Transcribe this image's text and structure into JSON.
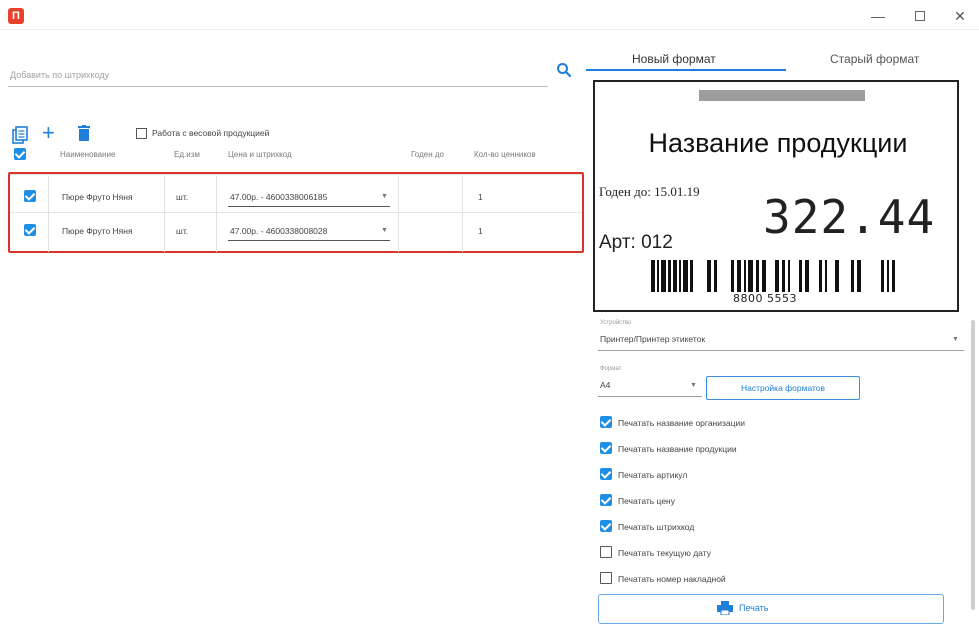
{
  "window": {
    "icon_glyph": "П",
    "minimize": "—",
    "close": "✕"
  },
  "left": {
    "search": {
      "placeholder": "Добавить по штрихкоду"
    },
    "weight_label": "Работа с весовой продукцией",
    "columns": [
      "Наименование",
      "Ед.изм",
      "Цена и штрихкод",
      "Годен до",
      "Кол-во ценников"
    ],
    "rows": [
      {
        "name": "Пюре Фруто Няня",
        "unit": "шт.",
        "price_barcode": "47.00р. - 4600338006185",
        "valid": "",
        "qty": "1"
      },
      {
        "name": "Пюре Фруто Няня",
        "unit": "шт.",
        "price_barcode": "47.00р. - 4600338008028",
        "valid": "",
        "qty": "1"
      }
    ]
  },
  "right": {
    "tabs": [
      "Новый формат",
      "Старый формат"
    ],
    "preview": {
      "product_name": "Название продукции",
      "valid_until": "Годен до: 15.01.19",
      "price": "322.44",
      "article": "Арт: 012",
      "barcode_number": "8800  5553"
    },
    "device": {
      "caption": "Устройство",
      "value": "Принтер/Принтер этикеток"
    },
    "format": {
      "caption": "Формат",
      "value": "А4"
    },
    "setup_button": "Настройка форматов",
    "options": [
      {
        "label": "Печатать название организации",
        "checked": true
      },
      {
        "label": "Печатать название продукции",
        "checked": true
      },
      {
        "label": "Печатать артикул",
        "checked": true
      },
      {
        "label": "Печатать цену",
        "checked": true
      },
      {
        "label": "Печатать штрихкод",
        "checked": true
      },
      {
        "label": "Печатать текущую дату",
        "checked": false
      },
      {
        "label": "Печатать номер накладной",
        "checked": false
      }
    ],
    "print_button": "Печать"
  },
  "colors": {
    "accent": "#1f8fe6",
    "selection": "#d9342b",
    "app_icon": "#e8412c"
  }
}
